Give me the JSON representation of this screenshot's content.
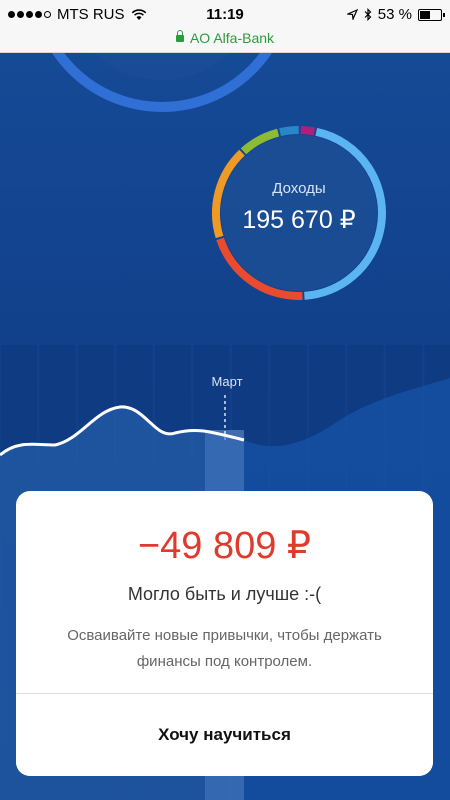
{
  "status_bar": {
    "carrier": "MTS RUS",
    "time": "11:19",
    "battery_percent": "53 %",
    "battery_level": 0.53
  },
  "url_bar": {
    "site": "AO Alfa-Bank"
  },
  "donut": {
    "caption": "Доходы",
    "value": "195 670 ₽",
    "segments": [
      {
        "share": 0.46,
        "color": "#5bb5f0"
      },
      {
        "share": 0.21,
        "color": "#ea4b2f"
      },
      {
        "share": 0.18,
        "color": "#f09a26"
      },
      {
        "share": 0.08,
        "color": "#8dbb34"
      },
      {
        "share": 0.04,
        "color": "#2a86c8"
      },
      {
        "share": 0.03,
        "color": "#b0207a"
      }
    ]
  },
  "chart": {
    "highlight_label": "Март"
  },
  "card": {
    "amount": "−49 809 ₽",
    "title": "Могло быть и лучше :-(",
    "description": "Осваивайте новые привычки, чтобы держать финансы  под контролем.",
    "button_label": "Хочу научиться"
  },
  "colors": {
    "background": "#0f3c7c",
    "negative_amount": "#e03a2e",
    "url_secure": "#2a9d3b"
  }
}
